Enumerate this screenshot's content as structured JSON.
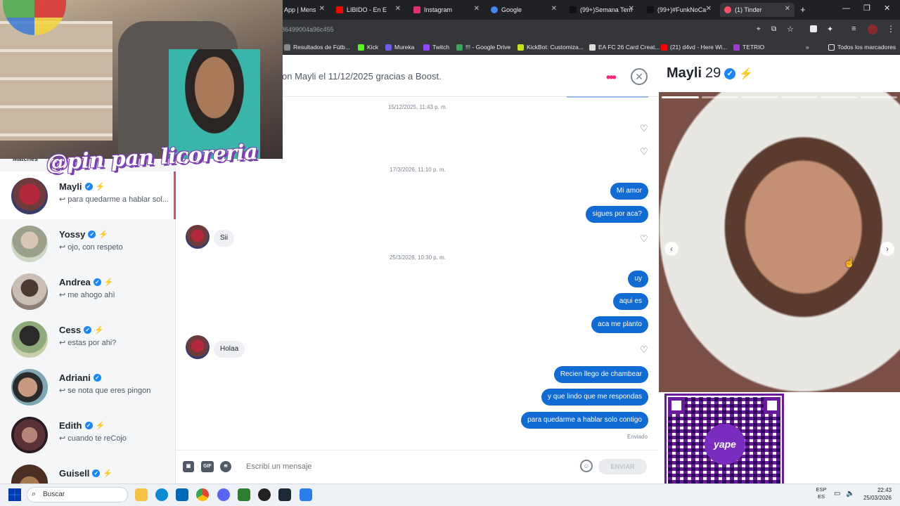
{
  "browser": {
    "tabs": [
      {
        "label": "App | Mens",
        "color": "#25d366"
      },
      {
        "label": "LIBIDO - En E",
        "color": "#ff0000"
      },
      {
        "label": "Instagram",
        "color": "#e1306c"
      },
      {
        "label": "Google",
        "color": "#4285f4"
      },
      {
        "label": "(99+)Semana Tem",
        "color": "#000000"
      },
      {
        "label": "(99+)#FunkNoCa",
        "color": "#000000"
      },
      {
        "label": "(1) Tinder",
        "color": "#fd5068"
      }
    ],
    "url": "86499004a96c455",
    "bookmarks": [
      "Resultados de Fútb...",
      "Kick",
      "Mureka",
      "Twitch",
      "!!! - Google Drive",
      "KickBot: Customiza...",
      "EA FC 26 Card Creat...",
      "(21) d4vd - Here Wi...",
      "TETRIO",
      "Todos los marcadores"
    ]
  },
  "overlay": {
    "watermark": "@pin pan licoreria"
  },
  "sidebar": {
    "section_label": "Matches",
    "matches": [
      {
        "name": "Mayli",
        "preview": "↩ para quedarme a hablar sol...",
        "bolt": "purple"
      },
      {
        "name": "Yossy",
        "preview": "↩ ojo, con respeto",
        "bolt": "gold"
      },
      {
        "name": "Andrea",
        "preview": "↩ me ahogo ahì",
        "bolt": "gold"
      },
      {
        "name": "Cess",
        "preview": "↩ estas por ahi?",
        "bolt": "gold"
      },
      {
        "name": "Adriani",
        "preview": "↩ se nota que eres pingon",
        "bolt": "none"
      },
      {
        "name": "Edith",
        "preview": "↩ cuando te reCojo",
        "bolt": "purple"
      },
      {
        "name": "Guisell",
        "preview": "",
        "bolt": "purple"
      }
    ]
  },
  "chat": {
    "header": "on Mayli el 11/12/2025 gracias a Boost.",
    "timestamps": [
      "15/12/2025, 11:43 p. m.",
      "17/3/2026, 11:10 p. m.",
      "25/3/2026, 10:30 p. m."
    ],
    "messages_out_1": [
      "Mi amor",
      "sigues por aca?"
    ],
    "message_in_1": "Sii",
    "messages_out_2": [
      "uy",
      "aqui es",
      "aca me planto"
    ],
    "message_in_2": "Holaa",
    "messages_out_3": [
      "Recien llego de chambear",
      "y que lindo que me respondas",
      "para quedarme a hablar solo contigo"
    ],
    "status": "Enviado",
    "input_placeholder": "Escribí un mensaje",
    "send_label": "ENVIAR",
    "gif_label": "GIF"
  },
  "profile": {
    "name": "Mayli",
    "age": "29"
  },
  "qr": {
    "logo_text": "yape"
  },
  "taskbar": {
    "search_label": "Buscar",
    "lang_1": "ESP",
    "lang_2": "ES",
    "time": "22:43",
    "date": "25/03/2026"
  },
  "colors": {
    "accent": "#fd267a",
    "bubble": "#106bd5",
    "verified": "#1786ff"
  }
}
